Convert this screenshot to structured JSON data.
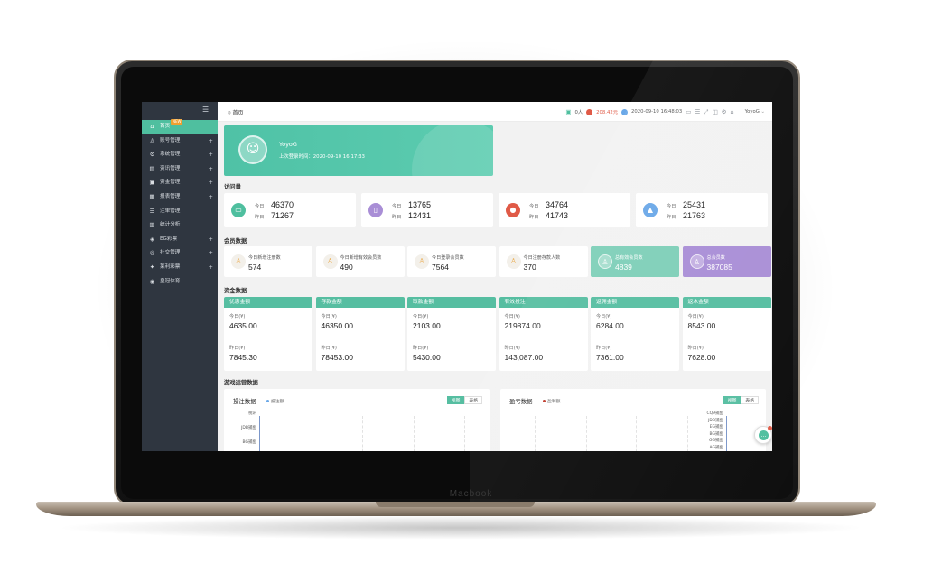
{
  "device": {
    "brand": "Macbook"
  },
  "colors": {
    "accent": "#4fbf9f",
    "sidebar": "#2f3640",
    "teal_card": "#7ecfb8",
    "purple_card": "#a98ed6",
    "red": "#e05a47"
  },
  "sidebar": {
    "toggle_icon": "menu-icon",
    "badge": "NEW",
    "items": [
      {
        "label": "首页",
        "icon": "home-icon",
        "active": true,
        "plus": ""
      },
      {
        "label": "账号管理",
        "icon": "user-icon",
        "plus": "+"
      },
      {
        "label": "系统管理",
        "icon": "settings-icon",
        "plus": "+"
      },
      {
        "label": "资讯管理",
        "icon": "document-icon",
        "plus": "+"
      },
      {
        "label": "资金管理",
        "icon": "wallet-icon",
        "plus": "+"
      },
      {
        "label": "报表管理",
        "icon": "report-icon",
        "plus": "+"
      },
      {
        "label": "注单管理",
        "icon": "list-icon",
        "plus": ""
      },
      {
        "label": "统计分析",
        "icon": "chart-icon",
        "plus": ""
      },
      {
        "label": "EG彩票",
        "icon": "ticket-icon",
        "plus": "+"
      },
      {
        "label": "社交管理",
        "icon": "social-icon",
        "plus": "+"
      },
      {
        "label": "莱利彩票",
        "icon": "lottery-icon",
        "plus": "+"
      },
      {
        "label": "皇冠体育",
        "icon": "sports-icon",
        "plus": ""
      }
    ]
  },
  "topbar": {
    "breadcrumb": "首页",
    "online": "0人",
    "balance": "208.42元",
    "datetime": "2020-09-10 16:48:03",
    "user": "YoyoG"
  },
  "hero": {
    "name": "YoyoG",
    "last_login": "上次登录时间：2020-09-10 16:17:33"
  },
  "sections": {
    "visits": "访问量",
    "members": "会员数据",
    "funds": "资金数据",
    "games": "游戏运营数据"
  },
  "visits": [
    {
      "icon": "monitor-icon",
      "today_label": "今日",
      "yesterday_label": "昨日",
      "today": "46370",
      "yesterday": "71267",
      "color": "#4fbf9f"
    },
    {
      "icon": "tablet-icon",
      "today_label": "今日",
      "yesterday_label": "昨日",
      "today": "13765",
      "yesterday": "12431",
      "color": "#a98ed6"
    },
    {
      "icon": "apple-icon",
      "today_label": "今日",
      "yesterday_label": "昨日",
      "today": "34764",
      "yesterday": "41743",
      "color": "#e05a47"
    },
    {
      "icon": "android-icon",
      "today_label": "今日",
      "yesterday_label": "昨日",
      "today": "25431",
      "yesterday": "21763",
      "color": "#6aa8e8"
    }
  ],
  "members": [
    {
      "label": "今日新增注册数",
      "value": "574",
      "style": "plain"
    },
    {
      "label": "今日新增有效会员数",
      "value": "490",
      "style": "plain"
    },
    {
      "label": "今日登录会员数",
      "value": "7564",
      "style": "plain"
    },
    {
      "label": "今日注册存款人数",
      "value": "370",
      "style": "plain"
    },
    {
      "label": "总有效会员数",
      "value": "4839",
      "style": "teal"
    },
    {
      "label": "总会员数",
      "value": "387085",
      "style": "purple"
    }
  ],
  "funds": [
    {
      "title": "优惠金额",
      "today_label": "今日(¥)",
      "today": "4635.00",
      "yesterday_label": "昨日(¥)",
      "yesterday": "7845.30"
    },
    {
      "title": "存款金额",
      "today_label": "今日(¥)",
      "today": "46350.00",
      "yesterday_label": "昨日(¥)",
      "yesterday": "78453.00"
    },
    {
      "title": "取款金额",
      "today_label": "今日(¥)",
      "today": "2103.00",
      "yesterday_label": "昨日(¥)",
      "yesterday": "5430.00"
    },
    {
      "title": "有效投注",
      "today_label": "今日(¥)",
      "today": "219874.00",
      "yesterday_label": "昨日(¥)",
      "yesterday": "143,087.00"
    },
    {
      "title": "返佣金额",
      "today_label": "今日(¥)",
      "today": "6284.00",
      "yesterday_label": "昨日(¥)",
      "yesterday": "7361.00"
    },
    {
      "title": "返水金额",
      "today_label": "今日(¥)",
      "today": "8543.00",
      "yesterday_label": "昨日(¥)",
      "yesterday": "7628.00"
    }
  ],
  "games": [
    {
      "title": "投注数据",
      "legend": "投注额",
      "legend_color": "#6aa8e8",
      "view": "视图",
      "table": "表格",
      "categories": [
        "视讯",
        "JDB捕鱼",
        "BG捕鱼"
      ]
    },
    {
      "title": "盈亏数据",
      "legend": "盈利额",
      "legend_color": "#c0392b",
      "view": "视图",
      "table": "表格",
      "categories": [
        "CQ9捕鱼",
        "JDB捕鱼",
        "EG捕鱼",
        "BG捕鱼",
        "GG捕鱼",
        "AG捕鱼"
      ]
    }
  ]
}
